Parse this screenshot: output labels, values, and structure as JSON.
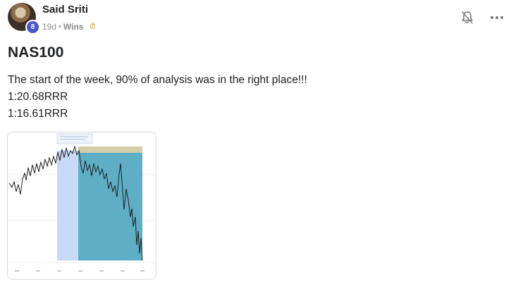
{
  "post": {
    "author": {
      "name": "Said Sriti",
      "level": "8",
      "avatar_icon": "user-avatar"
    },
    "meta": {
      "time": "19d",
      "separator": "•",
      "category": "Wins",
      "category_icon": "clapping-hands-icon"
    },
    "title": "NAS100",
    "body_lines": [
      "The start of the week, 90% of analysis was in the right place!!!",
      "1:20.68RRR",
      "1:16.61RRR"
    ],
    "actions": {
      "bell_icon": "bell-icon",
      "more_icon": "more-options-icon"
    },
    "attachment": {
      "type": "chart-screenshot",
      "colors": {
        "long_zone": "#c6d9f7",
        "short_zone": "#5eaec6",
        "target_band": "#d3ceaa",
        "price_line": "#1f1f1f"
      }
    }
  }
}
